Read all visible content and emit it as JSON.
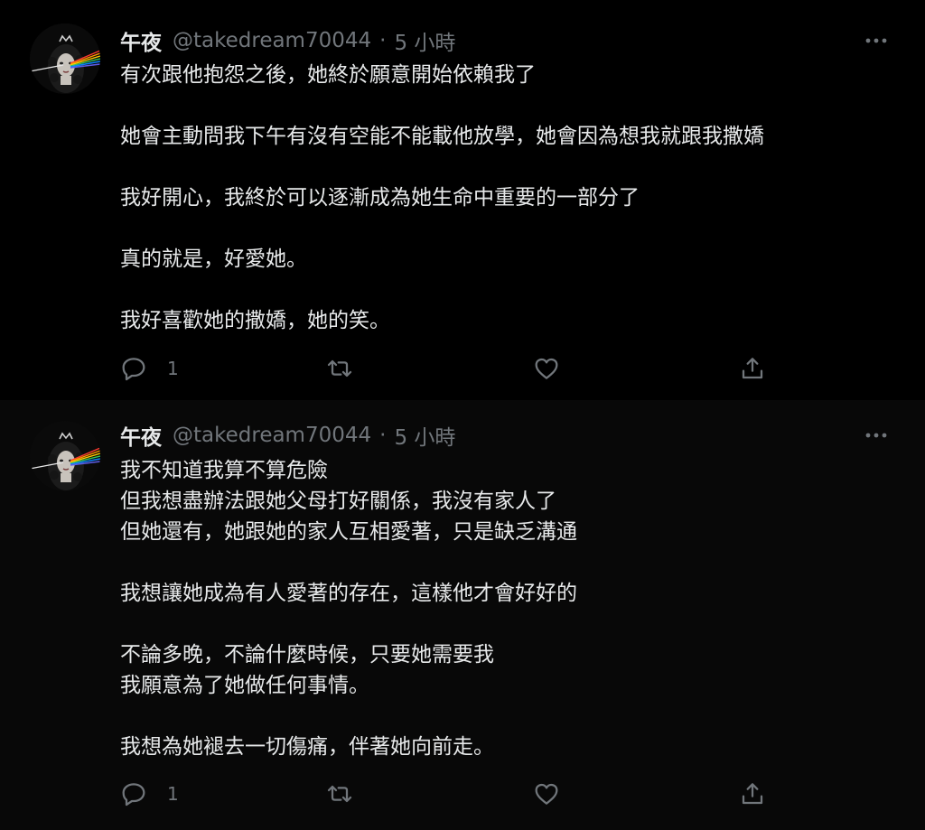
{
  "colors": {
    "background": "#000000",
    "text": "#e7e9ea",
    "secondary": "#71767b",
    "thread_line": "#3a3d40"
  },
  "tweets": [
    {
      "author": {
        "name": "午夜",
        "handle": "@takedream70044",
        "avatar_icon": "avatar-prism-portrait"
      },
      "separator": "·",
      "time": "5 小時",
      "more_icon": "more-dots-icon",
      "lines": [
        "有次跟他抱怨之後，她終於願意開始依賴我了",
        "",
        "她會主動問我下午有沒有空能不能載他放學，她會因為想我就跟我撒嬌",
        "",
        "我好開心，我終於可以逐漸成為她生命中重要的一部分了",
        "",
        "真的就是，好愛她。",
        "",
        "我好喜歡她的撒嬌，她的笑。"
      ],
      "actions": {
        "reply_count": "1",
        "reply_icon": "reply-icon",
        "retweet_icon": "retweet-icon",
        "like_icon": "heart-icon",
        "share_icon": "share-icon"
      }
    },
    {
      "author": {
        "name": "午夜",
        "handle": "@takedream70044",
        "avatar_icon": "avatar-prism-portrait"
      },
      "separator": "·",
      "time": "5 小時",
      "more_icon": "more-dots-icon",
      "lines": [
        "我不知道我算不算危險",
        "但我想盡辦法跟她父母打好關係，我沒有家人了",
        "但她還有，她跟她的家人互相愛著，只是缺乏溝通",
        "",
        "我想讓她成為有人愛著的存在，這樣他才會好好的",
        "",
        "不論多晚，不論什麼時候，只要她需要我",
        "我願意為了她做任何事情。",
        "",
        "我想為她褪去一切傷痛，伴著她向前走。"
      ],
      "actions": {
        "reply_count": "1",
        "reply_icon": "reply-icon",
        "retweet_icon": "retweet-icon",
        "like_icon": "heart-icon",
        "share_icon": "share-icon"
      }
    }
  ]
}
